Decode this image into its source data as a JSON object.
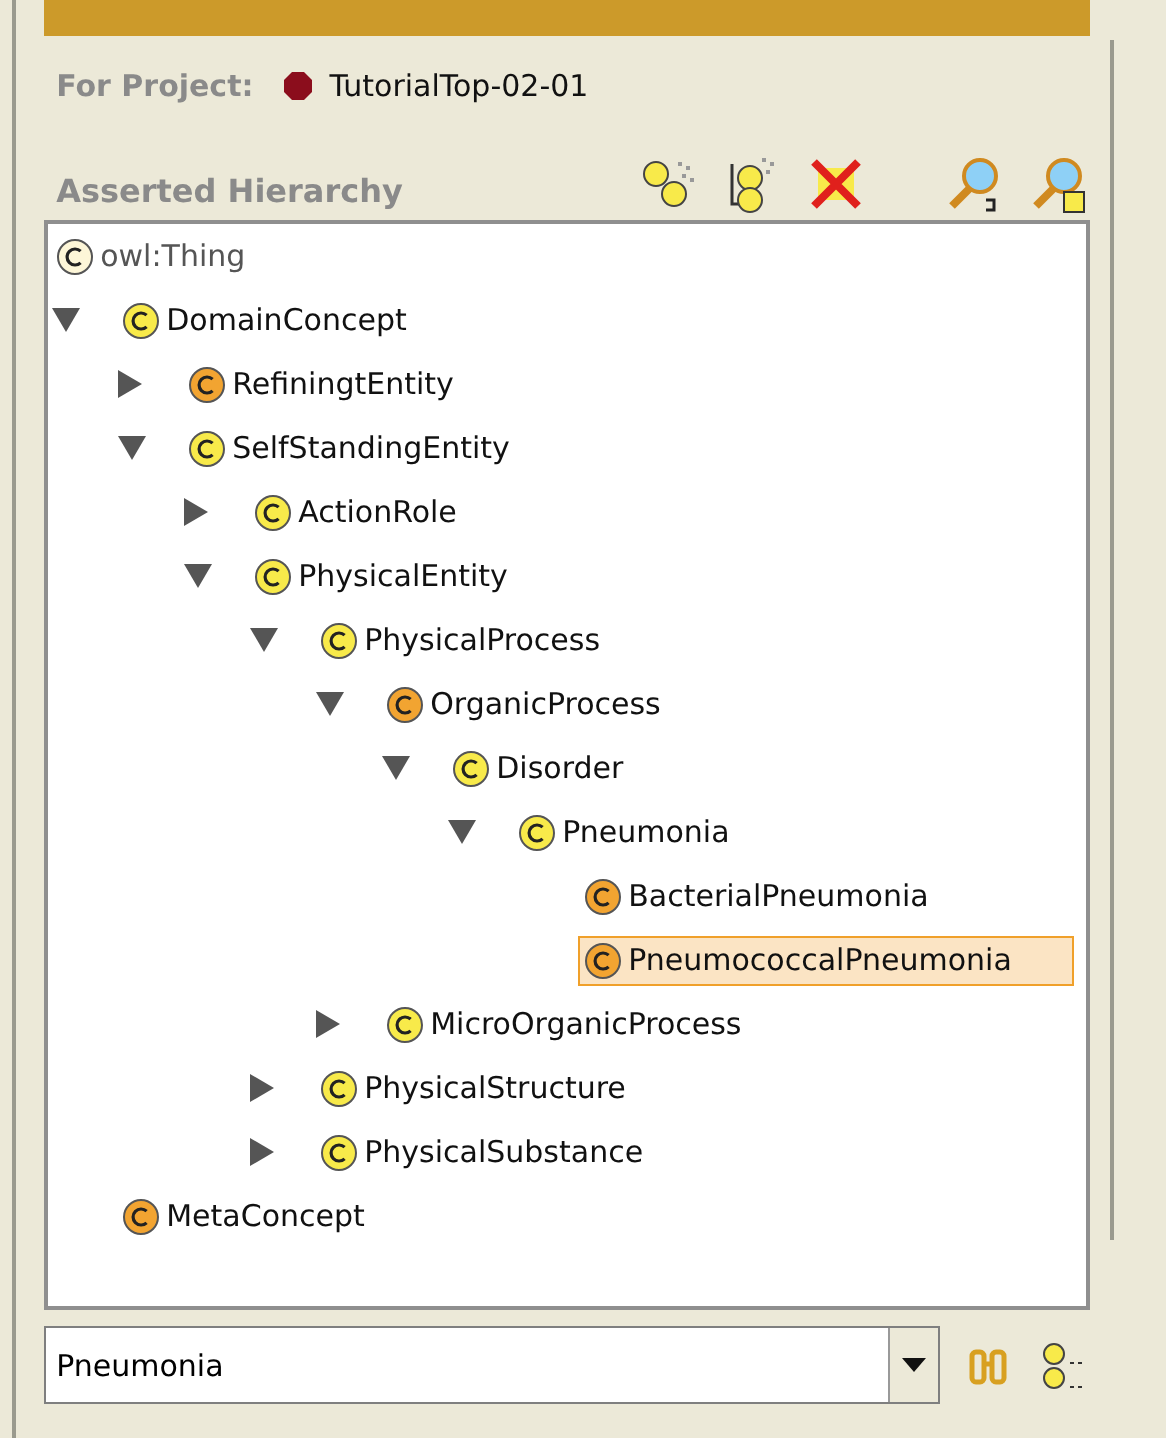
{
  "project": {
    "label": "For Project:",
    "name": "TutorialTop-02-01"
  },
  "hierarchy": {
    "title": "Asserted Hierarchy",
    "tree": [
      {
        "name": "owl:Thing",
        "kind": "root",
        "color": "#fdf6d8",
        "selected": false,
        "children": [
          {
            "name": "DomainConcept",
            "kind": "branch",
            "expanded": true,
            "color": "#f8ea4a",
            "selected": false,
            "children": [
              {
                "name": "RefiningtEntity",
                "kind": "branch",
                "expanded": false,
                "color": "#f2a431",
                "selected": false
              },
              {
                "name": "SelfStandingEntity",
                "kind": "branch",
                "expanded": true,
                "color": "#f8ea4a",
                "selected": false,
                "children": [
                  {
                    "name": "ActionRole",
                    "kind": "branch",
                    "expanded": false,
                    "color": "#f8ea4a",
                    "selected": false
                  },
                  {
                    "name": "PhysicalEntity",
                    "kind": "branch",
                    "expanded": true,
                    "color": "#f8ea4a",
                    "selected": false,
                    "children": [
                      {
                        "name": "PhysicalProcess",
                        "kind": "branch",
                        "expanded": true,
                        "color": "#f8ea4a",
                        "selected": false,
                        "children": [
                          {
                            "name": "OrganicProcess",
                            "kind": "branch",
                            "expanded": true,
                            "color": "#f2a431",
                            "selected": false,
                            "children": [
                              {
                                "name": "Disorder",
                                "kind": "branch",
                                "expanded": true,
                                "color": "#f8ea4a",
                                "selected": false,
                                "children": [
                                  {
                                    "name": "Pneumonia",
                                    "kind": "branch",
                                    "expanded": true,
                                    "color": "#f8ea4a",
                                    "selected": false,
                                    "children": [
                                      {
                                        "name": "BacterialPneumonia",
                                        "kind": "leaf",
                                        "color": "#f2a431",
                                        "selected": false
                                      },
                                      {
                                        "name": "PneumococcalPneumonia",
                                        "kind": "leaf",
                                        "color": "#f2a431",
                                        "selected": true
                                      }
                                    ]
                                  }
                                ]
                              }
                            ]
                          },
                          {
                            "name": "MicroOrganicProcess",
                            "kind": "branch",
                            "expanded": false,
                            "color": "#f8ea4a",
                            "selected": false
                          }
                        ]
                      },
                      {
                        "name": "PhysicalStructure",
                        "kind": "branch",
                        "expanded": false,
                        "color": "#f8ea4a",
                        "selected": false
                      },
                      {
                        "name": "PhysicalSubstance",
                        "kind": "branch",
                        "expanded": false,
                        "color": "#f8ea4a",
                        "selected": false
                      }
                    ]
                  }
                ]
              }
            ]
          },
          {
            "name": "MetaConcept",
            "kind": "leaf",
            "color": "#f2a431",
            "selected": false
          }
        ]
      }
    ]
  },
  "search": {
    "value": "Pneumonia"
  }
}
